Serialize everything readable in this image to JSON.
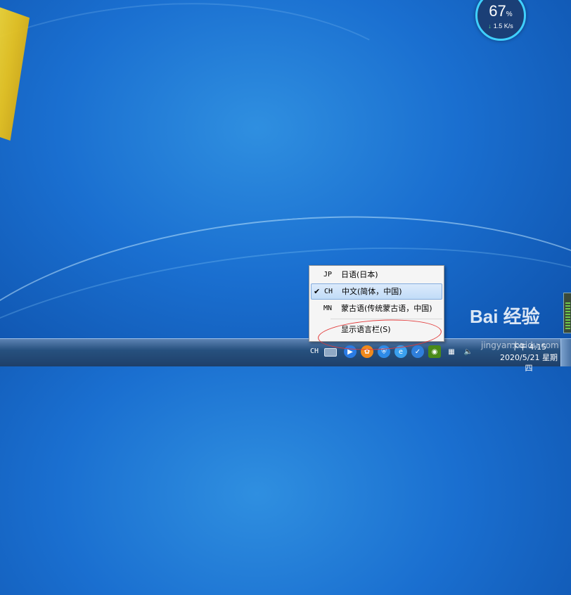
{
  "desktop": {
    "net_monitor": {
      "percent": "67",
      "percent_unit": "%",
      "rate": "1.5 K/s"
    }
  },
  "language_menu": {
    "items": [
      {
        "code": "JP",
        "label": "日语(日本)",
        "checked": false
      },
      {
        "code": "CH",
        "label": "中文(简体，中国)",
        "checked": true
      },
      {
        "code": "MN",
        "label": "蒙古语(传统蒙古语，中国)",
        "checked": false
      }
    ],
    "show_langbar_label": "显示语言栏(S)",
    "check_mark": "✔"
  },
  "taskbar": {
    "lang_indicator": "CH",
    "clock_time": "下午 4:15",
    "clock_date": "2020/5/21 星期四",
    "tray_icons": [
      "media-player-icon",
      "app-icon",
      "security-shield-icon",
      "browser-icon",
      "safe-guard-icon",
      "nvidia-icon",
      "network-icon",
      "volume-icon"
    ]
  },
  "watermark": {
    "brand": "Bai  经验",
    "url": "jingyan.baidu.com"
  },
  "colors": {
    "annotation": "#e23b3b",
    "selected_bg": "#c1dcf8"
  }
}
